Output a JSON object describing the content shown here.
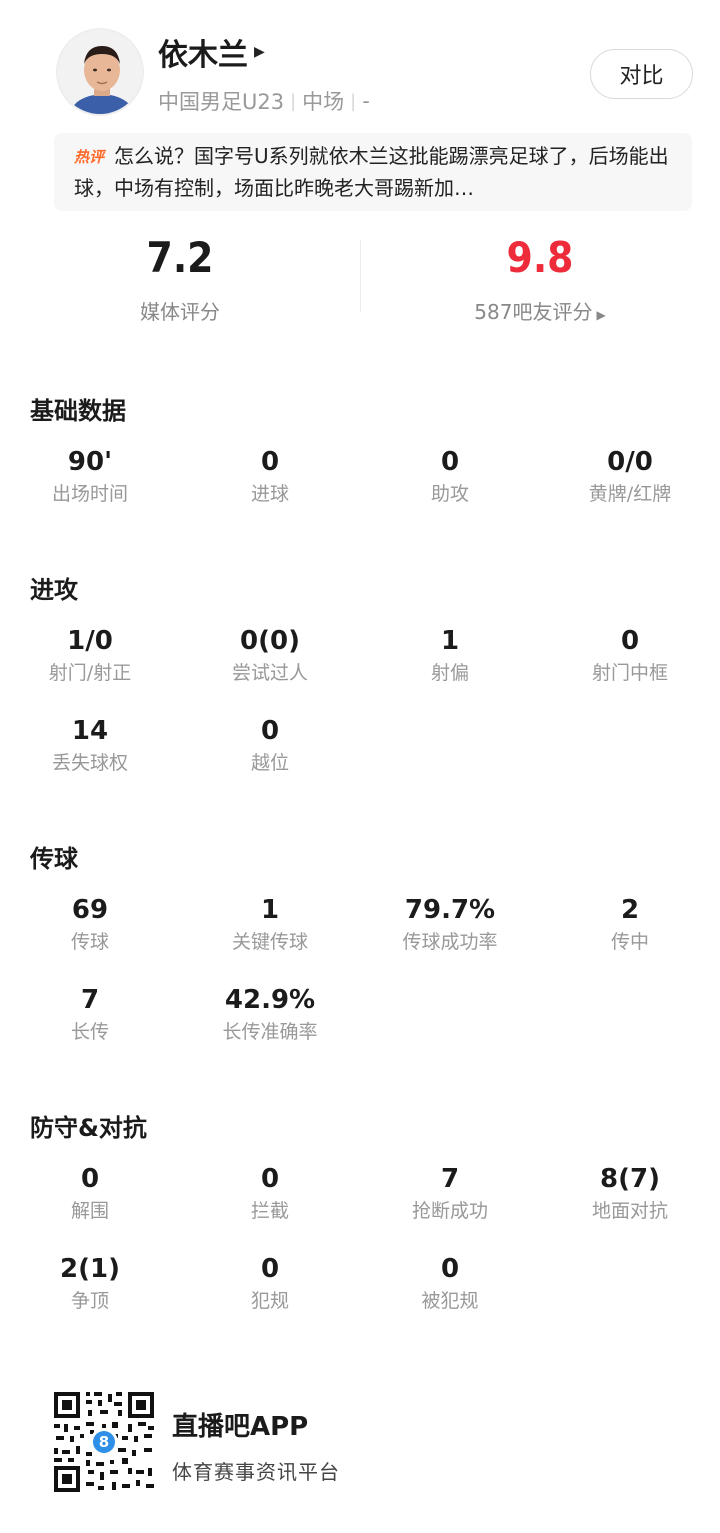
{
  "player": {
    "name": "依木兰",
    "team": "中国男足U23",
    "position": "中场",
    "extra": "-"
  },
  "compare_label": "对比",
  "hot_comment": {
    "badge": "热评",
    "text": "怎么说？国字号U系列就依木兰这批能踢漂亮足球了，后场能出球，中场有控制，场面比昨晚老大哥踢新加…"
  },
  "ratings": {
    "media_value": "7.2",
    "media_label": "媒体评分",
    "fans_value": "9.8",
    "fans_label": "587吧友评分"
  },
  "sections": {
    "basic": {
      "title": "基础数据",
      "stats": [
        {
          "value": "90'",
          "label": "出场时间"
        },
        {
          "value": "0",
          "label": "进球"
        },
        {
          "value": "0",
          "label": "助攻"
        },
        {
          "value": "0/0",
          "label": "黄牌/红牌"
        }
      ]
    },
    "attack": {
      "title": "进攻",
      "stats": [
        {
          "value": "1/0",
          "label": "射门/射正"
        },
        {
          "value": "0(0)",
          "label": "尝试过人"
        },
        {
          "value": "1",
          "label": "射偏"
        },
        {
          "value": "0",
          "label": "射门中框"
        },
        {
          "value": "14",
          "label": "丢失球权"
        },
        {
          "value": "0",
          "label": "越位"
        }
      ]
    },
    "passing": {
      "title": "传球",
      "stats": [
        {
          "value": "69",
          "label": "传球"
        },
        {
          "value": "1",
          "label": "关键传球"
        },
        {
          "value": "79.7%",
          "label": "传球成功率"
        },
        {
          "value": "2",
          "label": "传中"
        },
        {
          "value": "7",
          "label": "长传"
        },
        {
          "value": "42.9%",
          "label": "长传准确率"
        }
      ]
    },
    "defense": {
      "title": "防守&对抗",
      "stats": [
        {
          "value": "0",
          "label": "解围"
        },
        {
          "value": "0",
          "label": "拦截"
        },
        {
          "value": "7",
          "label": "抢断成功"
        },
        {
          "value": "8(7)",
          "label": "地面对抗"
        },
        {
          "value": "2(1)",
          "label": "争顶"
        },
        {
          "value": "0",
          "label": "犯规"
        },
        {
          "value": "0",
          "label": "被犯规"
        }
      ]
    }
  },
  "footer": {
    "app_name": "直播吧APP",
    "slogan": "体育赛事资讯平台",
    "qr_badge": "8"
  },
  "colors": {
    "fan_rating": "#ee2b3a",
    "hot_badge": "#ff6a2b",
    "muted_text": "#999999"
  }
}
